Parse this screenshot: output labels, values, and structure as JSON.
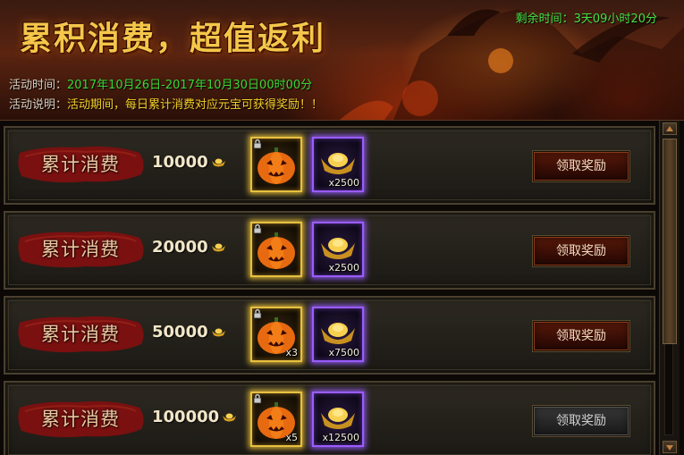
{
  "banner": {
    "title": "累积消费，超值返利",
    "remaining_label": "剩余时间：",
    "remaining_value": "3天09小时20分",
    "time_label": "活动时间：",
    "time_value": "2017年10月26日-2017年10月30日00时00分",
    "desc_label": "活动说明：",
    "desc_value": "活动期间，每日累计消费对应元宝可获得奖励！！"
  },
  "tiers": [
    {
      "label": "累计消费",
      "amount": "10000",
      "item_qty": "",
      "gold_qty": "x2500",
      "button": "领取奖励",
      "button_enabled": true
    },
    {
      "label": "累计消费",
      "amount": "20000",
      "item_qty": "",
      "gold_qty": "x2500",
      "button": "领取奖励",
      "button_enabled": true
    },
    {
      "label": "累计消费",
      "amount": "50000",
      "item_qty": "x3",
      "gold_qty": "x7500",
      "button": "领取奖励",
      "button_enabled": true
    },
    {
      "label": "累计消费",
      "amount": "100000",
      "item_qty": "x5",
      "gold_qty": "x12500",
      "button": "领取奖励",
      "button_enabled": false
    }
  ],
  "icons": {
    "item_icon": "pumpkin-icon",
    "reward_icon": "gold-ingot-icon",
    "currency_icon": "gold-ingot-icon",
    "bind_icon": "lock-icon"
  },
  "colors": {
    "title": "#f6c64a",
    "remaining": "#45e045",
    "time": "#38d838",
    "desc": "#f5d028",
    "label_banner": "#7a1010",
    "button_active": "#3a0e06",
    "button_disabled": "#262626"
  }
}
